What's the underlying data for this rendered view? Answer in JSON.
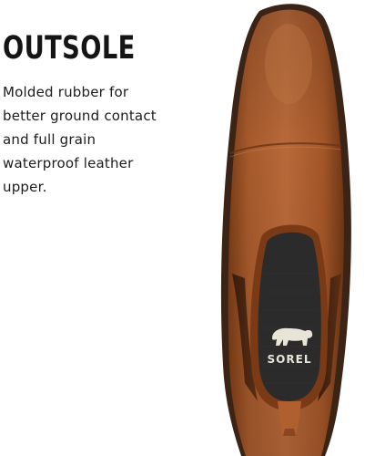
{
  "feature": {
    "title": "OUTSOLE",
    "description": "Molded rubber for better ground contact and full grain waterproof leather upper."
  },
  "product_image": {
    "subject": "boot-top-view",
    "colors": {
      "leather": "#a65a2c",
      "leather_dark": "#6e3716",
      "sole": "#3b2416",
      "lining": "#2b2b2b",
      "elastic_gore": "#4a2612"
    }
  },
  "logo": {
    "brand": "SOREL"
  }
}
